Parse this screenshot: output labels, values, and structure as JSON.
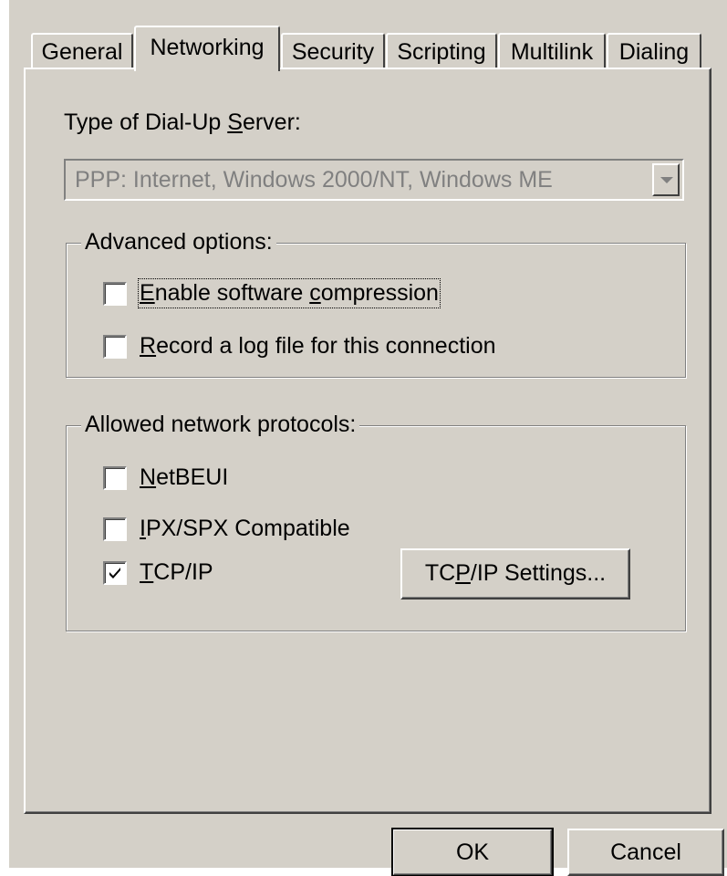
{
  "tabs": [
    {
      "pre": "General",
      "acc": "",
      "post": ""
    },
    {
      "pre": "Networking",
      "acc": "",
      "post": ""
    },
    {
      "pre": "Security",
      "acc": "",
      "post": ""
    },
    {
      "pre": "Scripting",
      "acc": "",
      "post": ""
    },
    {
      "pre": "Multilink",
      "acc": "",
      "post": ""
    },
    {
      "pre": "Dialing",
      "acc": "",
      "post": ""
    }
  ],
  "active_tab": "Networking",
  "server_type": {
    "label_pre": "Type of Dial-Up ",
    "label_acc": "S",
    "label_post": "erver:",
    "value": "PPP: Internet, Windows 2000/NT, Windows ME",
    "enabled": false
  },
  "advanced": {
    "title": "Advanced options:",
    "compression": {
      "pre": "",
      "acc": "E",
      "post": "nable software ",
      "acc2": "c",
      "post2": "ompression",
      "checked": false
    },
    "logfile": {
      "pre": "",
      "acc": "R",
      "post": "ecord a log file for this connection",
      "checked": false
    }
  },
  "protocols": {
    "title": "Allowed network protocols:",
    "netbeui": {
      "pre": "",
      "acc": "N",
      "post": "etBEUI",
      "checked": false
    },
    "ipx": {
      "pre": "",
      "acc": "I",
      "post": "PX/SPX Compatible",
      "checked": false
    },
    "tcpip": {
      "pre": "",
      "acc": "T",
      "post": "CP/IP",
      "checked": true
    }
  },
  "tcpip_settings_button": {
    "pre": "TC",
    "acc": "P",
    "post": "/IP Settings..."
  },
  "buttons": {
    "ok": "OK",
    "cancel": "Cancel"
  }
}
